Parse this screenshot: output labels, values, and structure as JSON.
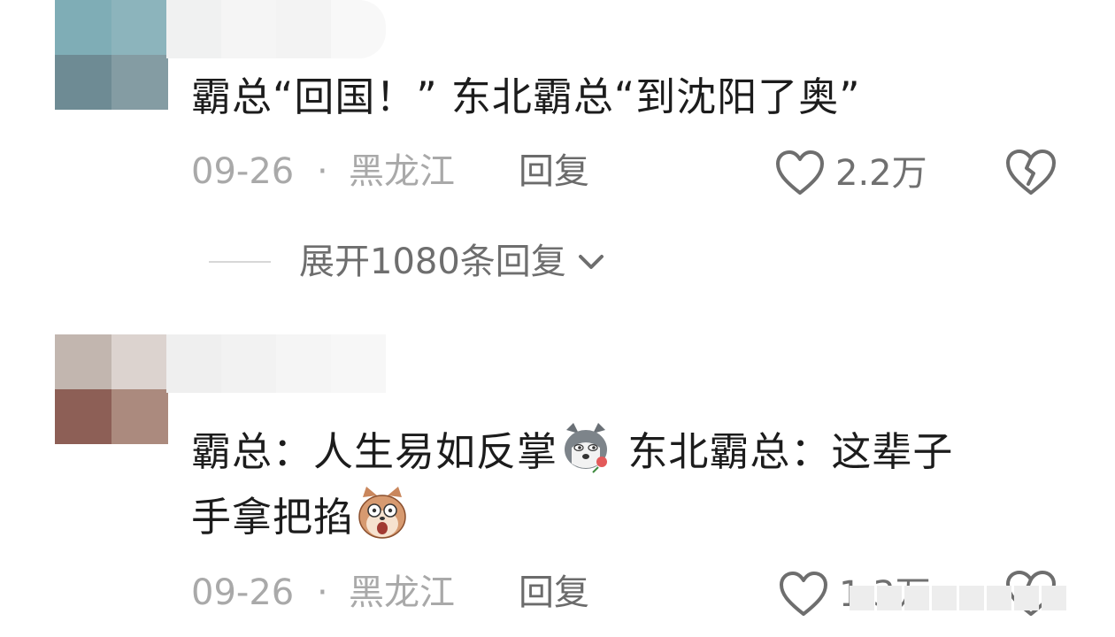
{
  "comments": [
    {
      "avatar_colors": [
        "#7fadb6",
        "#8cb4bc",
        "#6e8b94",
        "#849ca3"
      ],
      "name_blur_colors": [
        "#f0f1f1",
        "#f5f5f5",
        "#f3f3f3",
        "#f8f8f8"
      ],
      "text_line1": "霸总“回国！”  东北霸总“到沈阳了奥”",
      "date": "09-26",
      "separator": "·",
      "location": "黑龙江",
      "reply_label": "回复",
      "like_count": "2.2万",
      "dislike_icon": "broken-heart-icon"
    },
    {
      "avatar_colors": [
        "#c2b6af",
        "#dcd3cf",
        "#8d5f56",
        "#ab8a7e"
      ],
      "name_blur_colors": [
        "#efefef",
        "#f2f2f2",
        "#f5f5f5",
        "#f7f7f7"
      ],
      "text_line1_part1": "霸总：人生易如反掌",
      "sticker1": "husky-rose-sticker",
      "text_line1_part2": " 东北霸总：这辈子",
      "text_line2": "手拿把掐",
      "sticker2": "shocked-dog-sticker",
      "date": "09-26",
      "separator": "·",
      "location": "黑龙江",
      "reply_label": "回复",
      "like_count": "1.3万",
      "dislike_icon": "broken-heart-icon"
    }
  ],
  "expand_replies": {
    "label": "展开1080条回复",
    "icon": "chevron-down-icon"
  },
  "colors": {
    "meta_gray": "#a9a9a9",
    "reply_gray": "#6b6b6b",
    "text": "#1c1c1c"
  }
}
